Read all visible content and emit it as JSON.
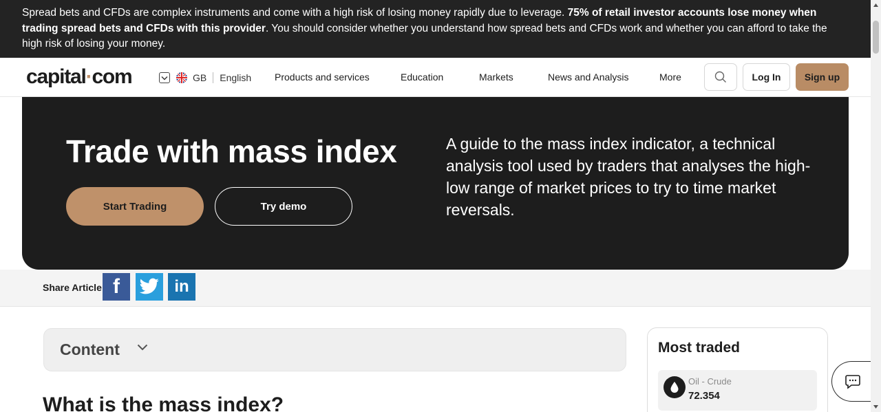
{
  "risk_warning": {
    "text_regular": "Spread bets and CFDs are complex instruments and come with a high risk of losing money rapidly due to leverage. ",
    "text_bold": "75% of retail investor accounts lose money when trading spread bets and CFDs with this provider",
    "text_tail": ". You should consider whether you understand how spread bets and CFDs work and whether you can afford to take the high risk of losing your money."
  },
  "header": {
    "logo_left": "capital",
    "logo_dot": "·",
    "logo_right": "com",
    "region": "GB",
    "language": "English",
    "nav": [
      "Products and services",
      "Education",
      "Markets",
      "News and Analysis",
      "More"
    ],
    "login_label": "Log In",
    "signup_label": "Sign up"
  },
  "hero": {
    "title": "Trade with mass index",
    "start_label": "Start Trading",
    "demo_label": "Try demo",
    "description": "A guide to the mass index indicator, a technical analysis tool used by traders that analyses the high-low range of market prices to try to time market reversals."
  },
  "share": {
    "label": "Share Article",
    "facebook": "f",
    "linkedin": "in"
  },
  "content_toc": {
    "title": "Content"
  },
  "article": {
    "heading": "What is the mass index?"
  },
  "most_traded": {
    "title": "Most traded",
    "items": [
      {
        "name": "Oil - Crude",
        "price": "72.354"
      }
    ]
  },
  "colors": {
    "accent": "#bf916a",
    "dark": "#1d1d1d",
    "facebook": "#3a5a98",
    "twitter": "#2a9fdd",
    "linkedin": "#1a74b0"
  }
}
